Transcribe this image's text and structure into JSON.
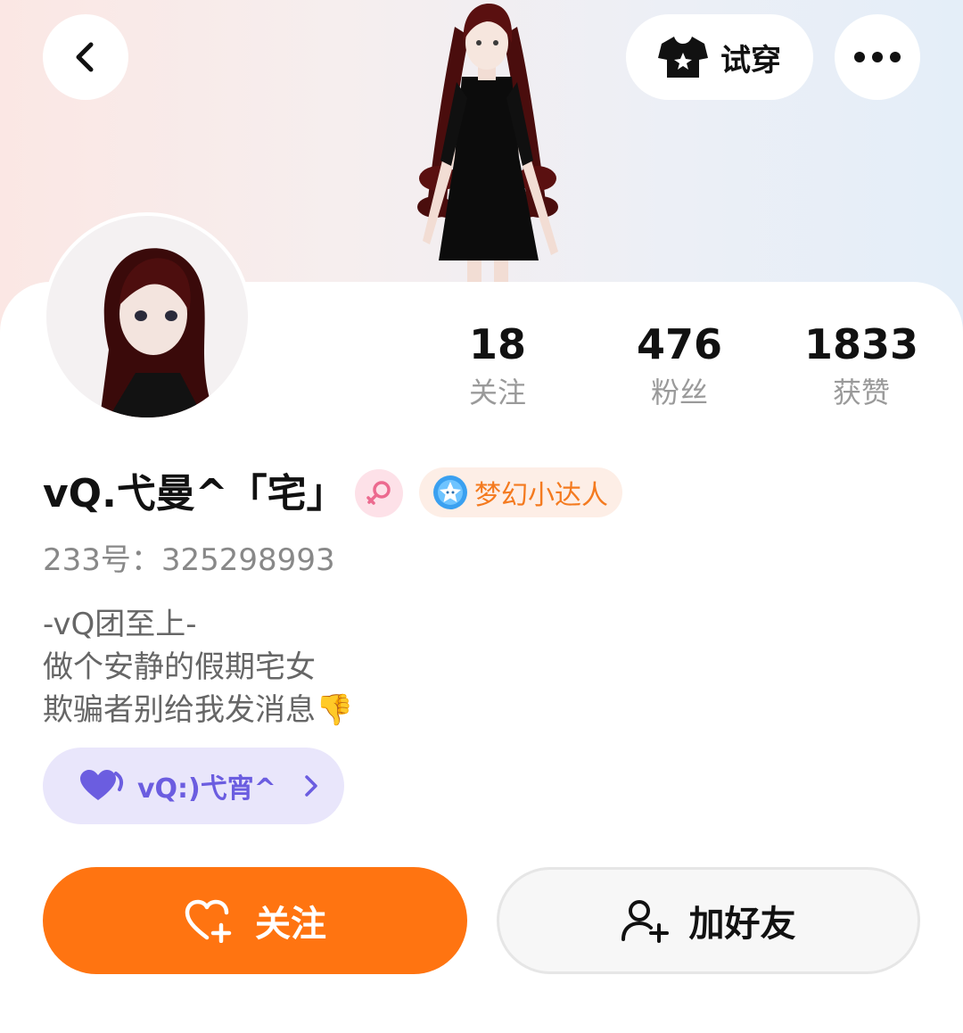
{
  "header": {
    "try_on_label": "试穿"
  },
  "stats": [
    {
      "value": "18",
      "label": "关注"
    },
    {
      "value": "476",
      "label": "粉丝"
    },
    {
      "value": "1833",
      "label": "获赞"
    }
  ],
  "profile": {
    "nickname": "vQ.弋曼^「宅」",
    "badge_label": "梦幻小达人",
    "uid": "233号：325298993",
    "bio": [
      "-vQ团至上-",
      "做个安静的假期宅女",
      "欺骗者别给我发消息👎"
    ]
  },
  "group": {
    "label": "vQ:)弋宵^"
  },
  "actions": {
    "follow_label": "关注",
    "add_friend_label": "加好友"
  },
  "colors": {
    "accent": "#ff7411",
    "badge_text": "#f47a1f",
    "group_bg": "#e9e6fb",
    "group_text": "#6b5de0",
    "gender_bg": "#fde1e8",
    "gender_icon": "#ec6a8f"
  },
  "icons": {
    "back": "chevron-left-icon",
    "try_on": "tshirt-icon",
    "more": "more-dots-icon",
    "gender": "female-icon",
    "badge": "star-face-icon",
    "group": "heart-icon",
    "follow": "heart-plus-icon",
    "add_friend": "person-plus-icon"
  }
}
